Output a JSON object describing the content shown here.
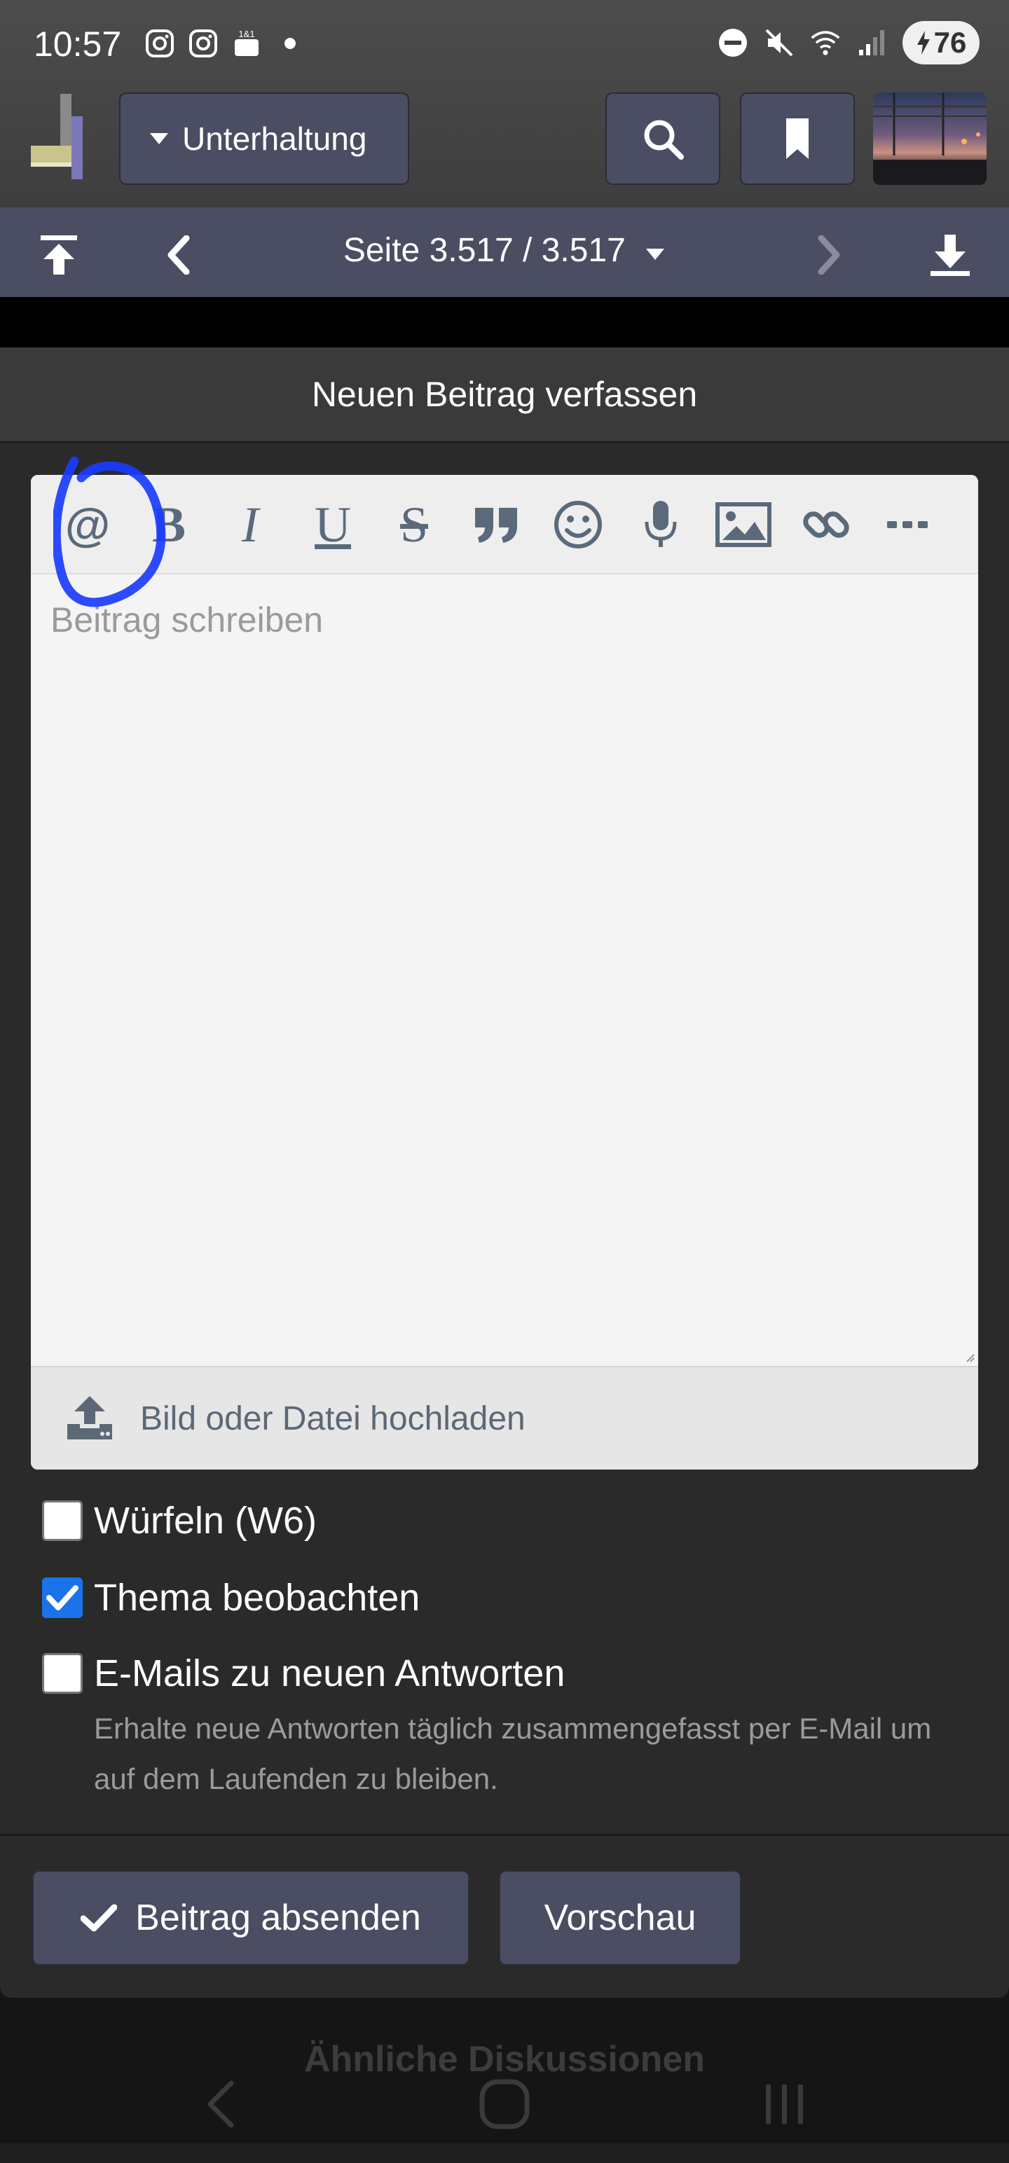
{
  "status_bar": {
    "time": "10:57",
    "icons_left": [
      "instagram-icon",
      "instagram-icon",
      "provider-1and1-icon",
      "dot-icon"
    ],
    "icons_right": [
      "dnd-icon",
      "mute-icon",
      "wifi-icon",
      "signal-icon"
    ],
    "battery": "76"
  },
  "header": {
    "forum_label": "Unterhaltung",
    "search_icon": "search-icon",
    "bookmark_icon": "bookmark-icon"
  },
  "pagination": {
    "label": "Seite 3.517 / 3.517"
  },
  "compose": {
    "title": "Neuen Beitrag verfassen",
    "toolbar": {
      "mention": "@",
      "bold": "B",
      "italic": "I",
      "underline": "U",
      "strike": "S"
    },
    "placeholder": "Beitrag schreiben",
    "upload_label": "Bild oder Datei hochladen"
  },
  "options": {
    "dice": "Würfeln (W6)",
    "watch": "Thema beobachten",
    "email": "E-Mails zu neuen Antworten",
    "email_hint": "Erhalte neue Antworten täglich zusammengefasst per E-Mail um auf dem Laufenden zu bleiben.",
    "dice_checked": false,
    "watch_checked": true,
    "email_checked": false
  },
  "actions": {
    "submit": "Beitrag absenden",
    "preview": "Vorschau"
  },
  "below": {
    "similar": "Ähnliche Diskussionen"
  },
  "colors": {
    "accent_blue": "#1a73e8",
    "button_bg": "#4b4d62",
    "annotation": "#1a3cff"
  }
}
